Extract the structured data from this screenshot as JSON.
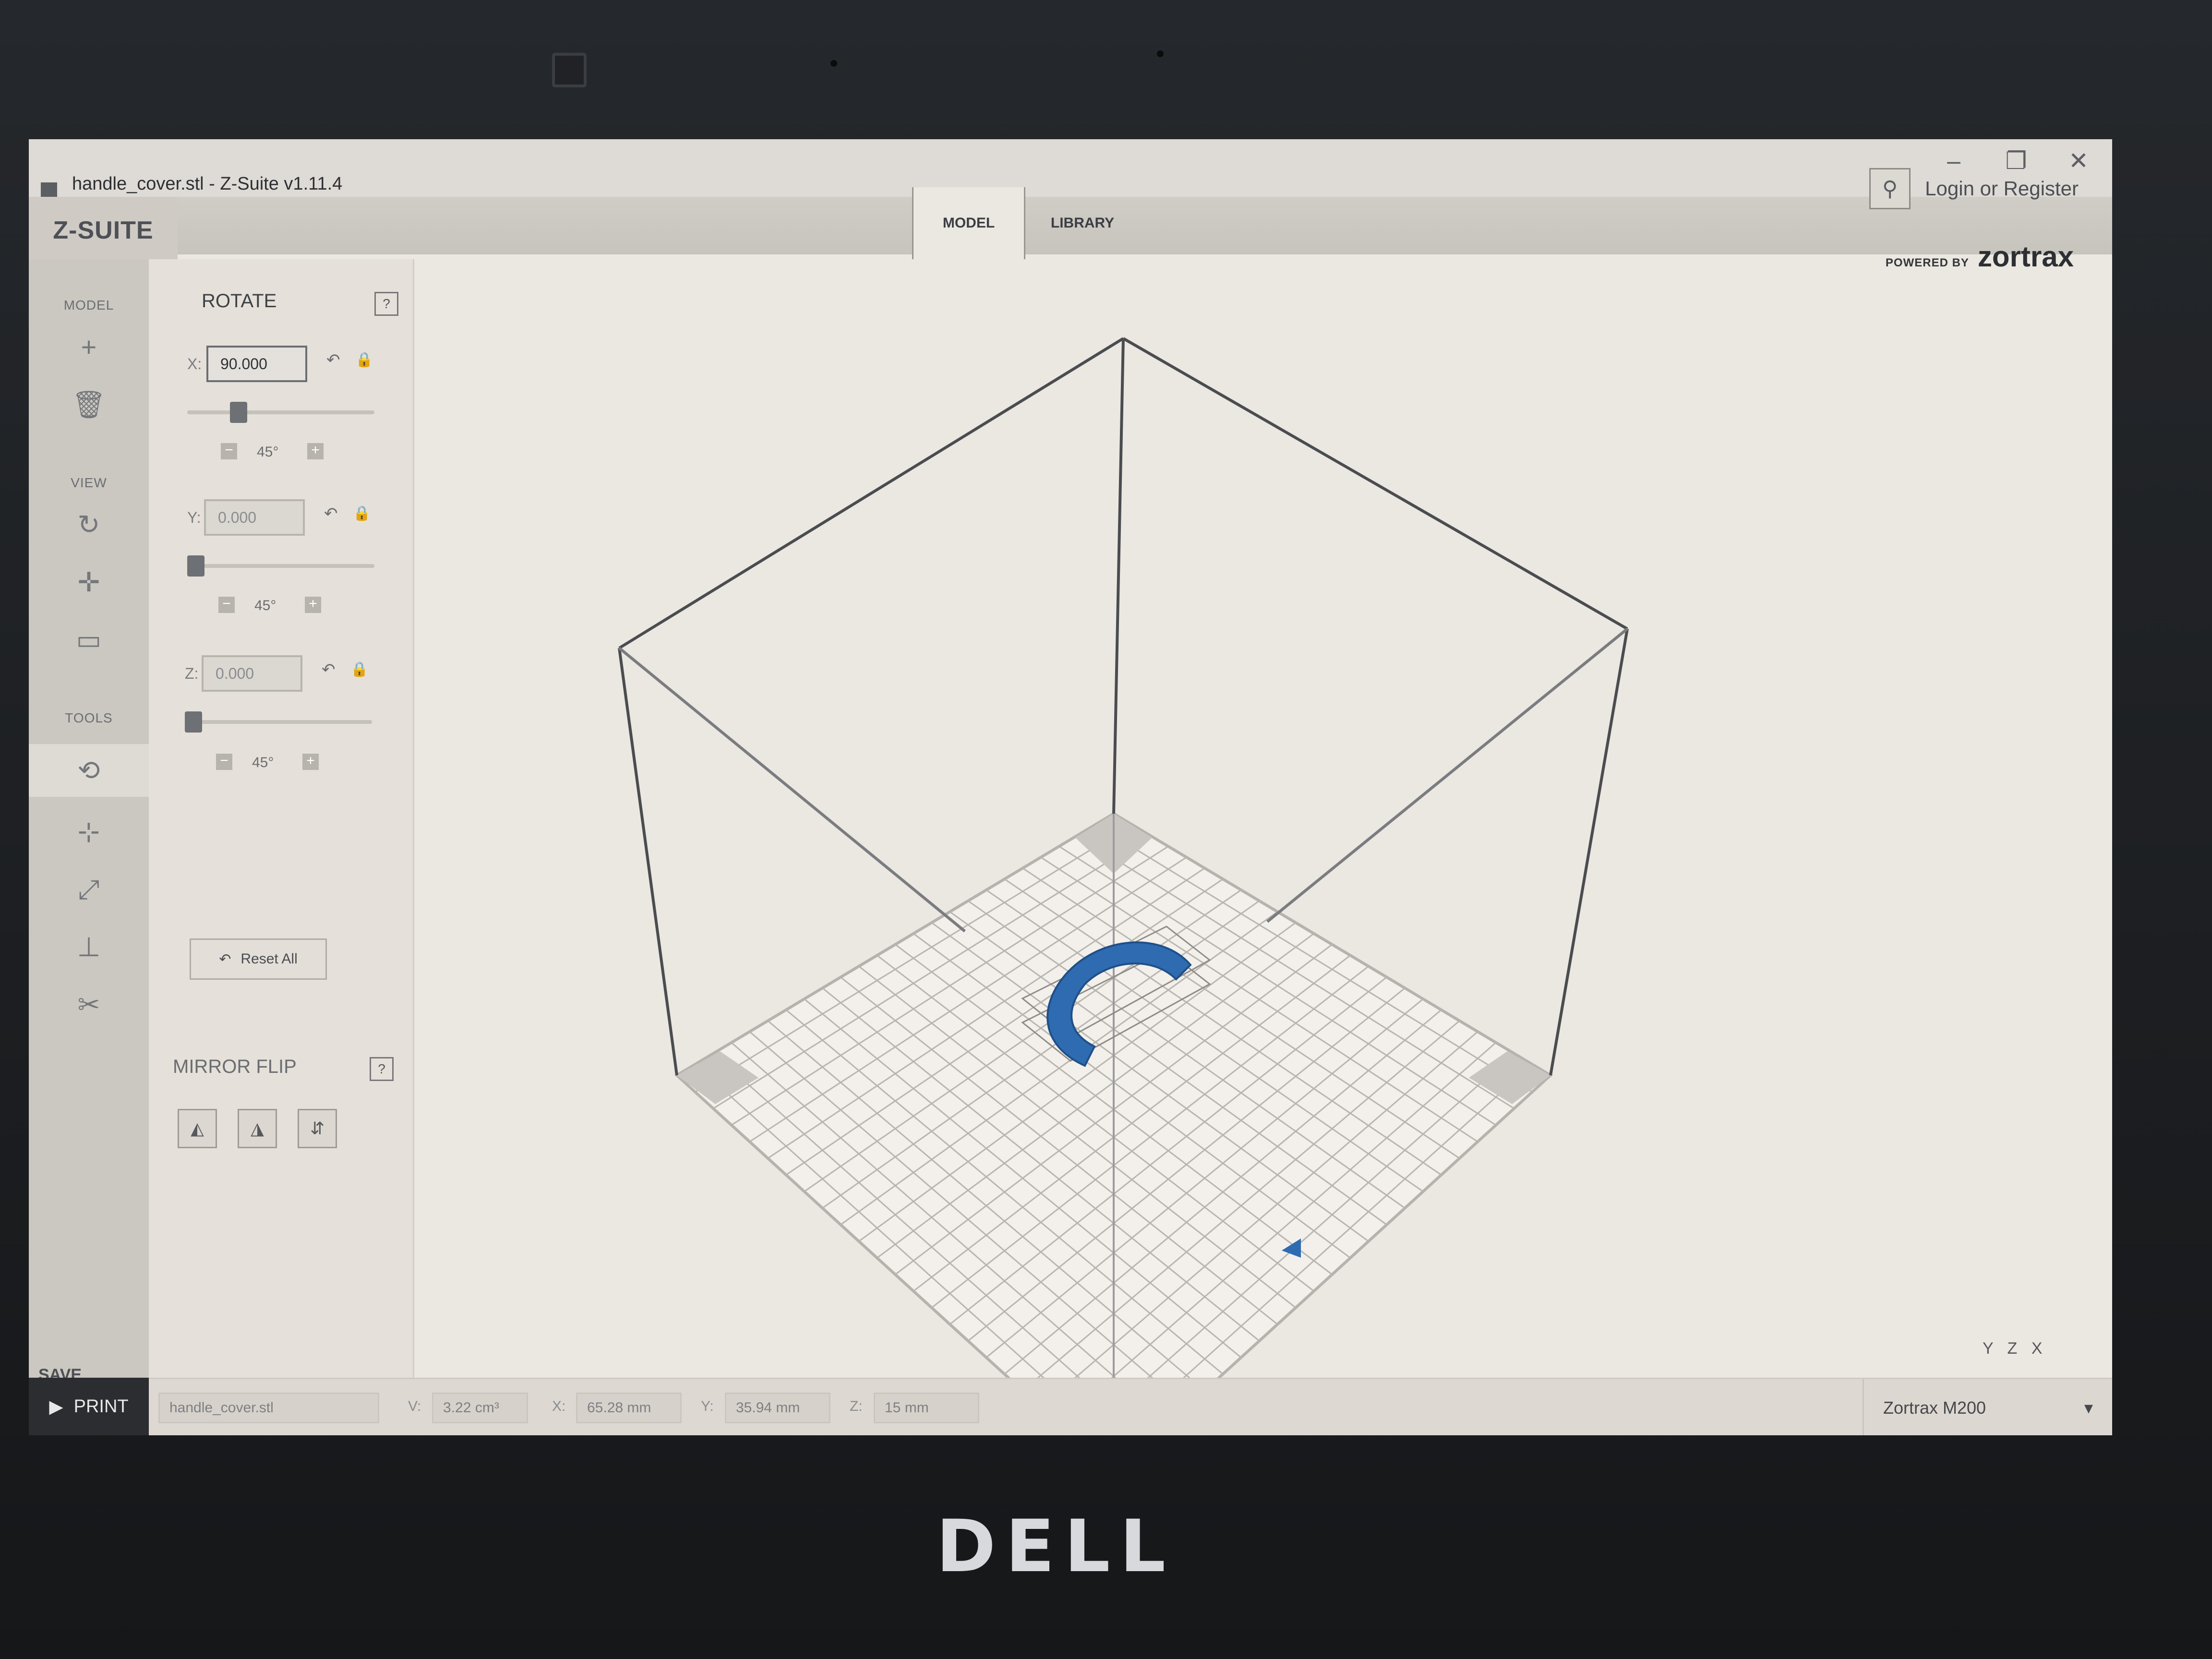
{
  "window": {
    "title": "handle_cover.stl - Z-Suite v1.11.4",
    "controls": [
      "–",
      "❐",
      "✕"
    ]
  },
  "brand": "Z-SUITE",
  "tabs": [
    {
      "label": "MODEL",
      "active": true
    },
    {
      "label": "LIBRARY",
      "active": false
    }
  ],
  "login": {
    "label": "Login or Register",
    "icon": "user-icon"
  },
  "powered": {
    "prefix": "POWERED BY",
    "brand": "zortrax"
  },
  "sidebar": {
    "sections": [
      {
        "heading": "MODEL",
        "icons": [
          "add-icon",
          "trash-icon"
        ]
      },
      {
        "heading": "VIEW",
        "icons": [
          "rotate-view-icon",
          "pan-icon",
          "camera-icon"
        ]
      },
      {
        "heading": "TOOLS",
        "icons": [
          "rotate-tool-icon",
          "move-icon",
          "scale-icon",
          "place-icon",
          "cut-icon"
        ]
      }
    ],
    "save_label": "SAVE PROJECT",
    "print_label": "PRINT"
  },
  "rotate": {
    "title": "ROTATE",
    "help": "?",
    "axes": [
      {
        "label": "X:",
        "value": "90.000",
        "step": "45°",
        "slider_fraction": 0.25,
        "active": true
      },
      {
        "label": "Y:",
        "value": "0.000",
        "step": "45°",
        "slider_fraction": 0.0,
        "active": false
      },
      {
        "label": "Z:",
        "value": "0.000",
        "step": "45°",
        "slider_fraction": 0.0,
        "active": false
      }
    ],
    "minus": "−",
    "plus": "+",
    "reset_all": "Reset All"
  },
  "mirror": {
    "title": "MIRROR FLIP",
    "help": "?",
    "buttons": [
      "flip-x-icon",
      "flip-y-icon",
      "flip-z-icon"
    ]
  },
  "viewport": {
    "model_color": "#2f6bb0",
    "gizmo": {
      "x": "X",
      "y": "Y",
      "z": "Z"
    }
  },
  "status": {
    "file": "handle_cover.stl",
    "v_label": "V:",
    "v_value": "3.22 cm³",
    "x_label": "X:",
    "x_value": "65.28 mm",
    "y_label": "Y:",
    "y_value": "35.94 mm",
    "z_label": "Z:",
    "z_value": "15 mm",
    "printer": "Zortrax M200"
  }
}
